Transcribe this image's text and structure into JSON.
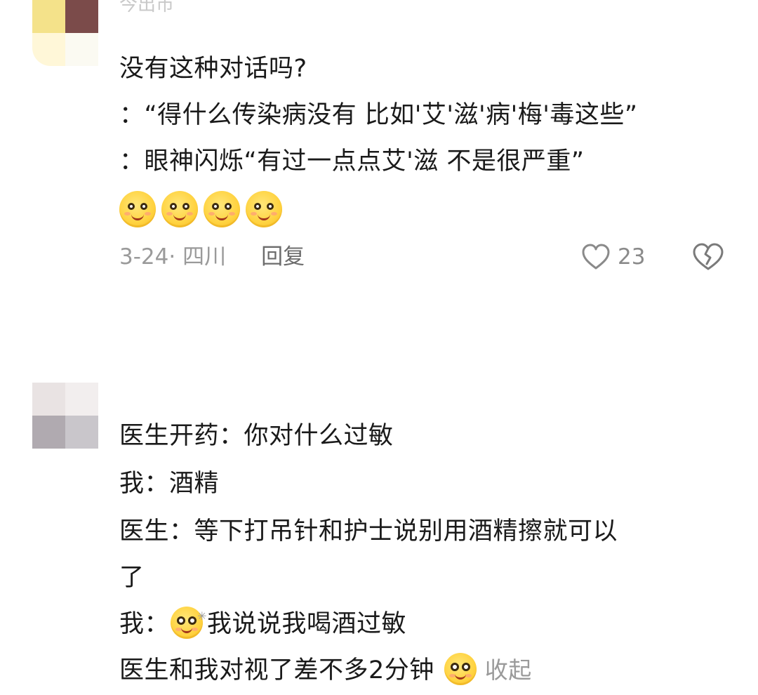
{
  "header_cut": "今出市",
  "comments": [
    {
      "avatar_colors": [
        "#f4e28a",
        "#7b4b4a",
        "#fff7d8",
        "#fbfaf2"
      ],
      "lines": [
        "没有这种对话吗?",
        "：“得什么传染病没有 比如'艾'滋'病'梅'毒这些”",
        "：眼神闪烁“有过一点点艾'滋 不是很严重”"
      ],
      "emojis": [
        "smile-emoji",
        "smile-emoji",
        "smile-emoji",
        "smile-emoji"
      ],
      "date_location": "3-24· 四川",
      "reply_label": "回复",
      "like_count": "23"
    },
    {
      "avatar_colors": [
        "#e9e3e3",
        "#f2eeee",
        "#b0aab0",
        "#c9c6cb"
      ],
      "line1": "医生开药：你对什么过敏",
      "line2": "我：酒精",
      "line3": "医生：等下打吊针和护士说别用酒精擦就可以",
      "line4": "了",
      "line5_prefix": "我：",
      "line5_text": "我说说我喝酒过敏",
      "line6": "医生和我对视了差不多2分钟",
      "collapse_label": "收起"
    }
  ],
  "colors": {
    "text_primary": "#1a1a1a",
    "text_meta": "#9a9a9a",
    "emoji_yellow": "#ffd23f"
  },
  "icons": [
    "heart-icon",
    "broken-heart-icon"
  ]
}
